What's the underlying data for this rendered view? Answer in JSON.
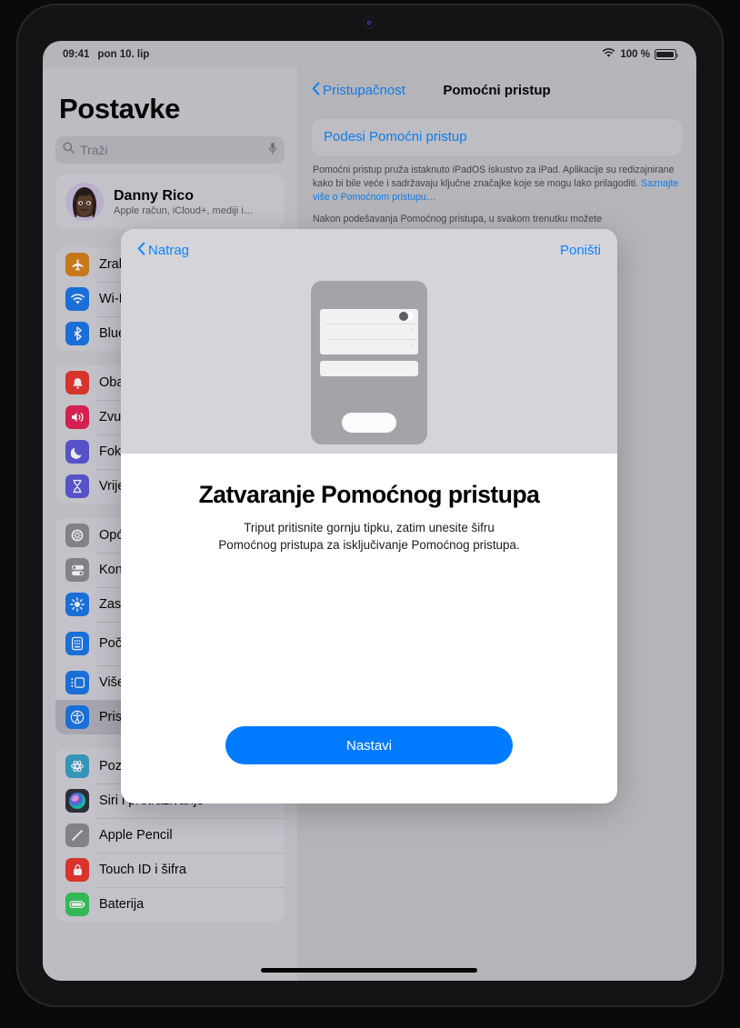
{
  "status_bar": {
    "time": "09:41",
    "date": "pon 10. lip",
    "wifi_icon": "wifi-icon",
    "battery_percent": "100 %",
    "battery_icon": "battery-full-icon"
  },
  "sidebar": {
    "title": "Postavke",
    "search": {
      "placeholder": "Traži",
      "icon": "search-icon",
      "mic_icon": "microphone-icon"
    },
    "profile": {
      "name": "Danny Rico",
      "subtitle": "Apple račun, iCloud+, mediji i…",
      "avatar": "memoji-avatar"
    },
    "groups": [
      {
        "items": [
          {
            "label": "Zrakoplovni način rada",
            "icon": "airplane-icon",
            "color": "#d67f18"
          },
          {
            "label": "Wi-Fi",
            "icon": "wifi-icon",
            "color": "#1775e8"
          },
          {
            "label": "Bluetooth",
            "icon": "bluetooth-icon",
            "color": "#1775e8"
          }
        ]
      },
      {
        "items": [
          {
            "label": "Obavijesti",
            "icon": "bell-icon",
            "color": "#e8342a"
          },
          {
            "label": "Zvukovi",
            "icon": "speaker-icon",
            "color": "#e51e52"
          },
          {
            "label": "Fokusiranje",
            "icon": "moon-icon",
            "color": "#5a55d6"
          },
          {
            "label": "Vrijeme ispred zaslona",
            "icon": "hourglass-icon",
            "color": "#5a55d6"
          }
        ]
      },
      {
        "items": [
          {
            "label": "Općenito",
            "icon": "gear-icon",
            "color": "#8a8a8e"
          },
          {
            "label": "Kontrolni centar",
            "icon": "switches-icon",
            "color": "#8a8a8e"
          },
          {
            "label": "Zaslon i svjetlina",
            "icon": "brightness-icon",
            "color": "#1775e8"
          },
          {
            "label": "Početni zaslon i medijateka",
            "icon": "home-screen-icon",
            "color": "#1775e8"
          },
          {
            "label": "Višezadaćnost i geste",
            "icon": "multitasking-icon",
            "color": "#1775e8"
          },
          {
            "label": "Pristupačnost",
            "icon": "accessibility-icon",
            "color": "#1775e8",
            "selected": true
          }
        ]
      },
      {
        "items": [
          {
            "label": "Pozadina",
            "icon": "wallpaper-icon",
            "color": "#36a0c4"
          },
          {
            "label": "Siri i pretraživanje",
            "icon": "siri-icon",
            "color": "#2d2d38"
          },
          {
            "label": "Apple Pencil",
            "icon": "pencil-icon",
            "color": "#8a8a8e"
          },
          {
            "label": "Touch ID i šifra",
            "icon": "lock-icon",
            "color": "#e8342a"
          },
          {
            "label": "Baterija",
            "icon": "battery-icon",
            "color": "#34c759"
          }
        ]
      }
    ]
  },
  "detail": {
    "back_label": "Pristupačnost",
    "back_icon": "chevron-left-icon",
    "title": "Pomoćni pristup",
    "card_link": "Podesi Pomoćni pristup",
    "paragraph_1": "Pomoćni pristup pruža istaknuto iPadOS iskustvo za iPad. Aplikacije su redizajnirane kako bi bile veće i sadržavaju ključne značajke koje se mogu lako prilagoditi. ",
    "paragraph_1_link": "Saznajte više o Pomoćnom pristupu…",
    "paragraph_2": "Nakon podešavanja Pomoćnog pristupa, u svakom trenutku možete"
  },
  "modal": {
    "back_label": "Natrag",
    "back_icon": "chevron-left-icon",
    "cancel_label": "Poništi",
    "illustration": "ipad-assistive-access-illustration",
    "heading": "Zatvaranje Pomoćnog pristupa",
    "description_line_1": "Triput pritisnite gornju tipku, zatim unesite šifru",
    "description_line_2": "Pomoćnog pristupa za isključivanje Pomoćnog pristupa.",
    "continue_label": "Nastavi",
    "accent_color": "#007aff"
  }
}
